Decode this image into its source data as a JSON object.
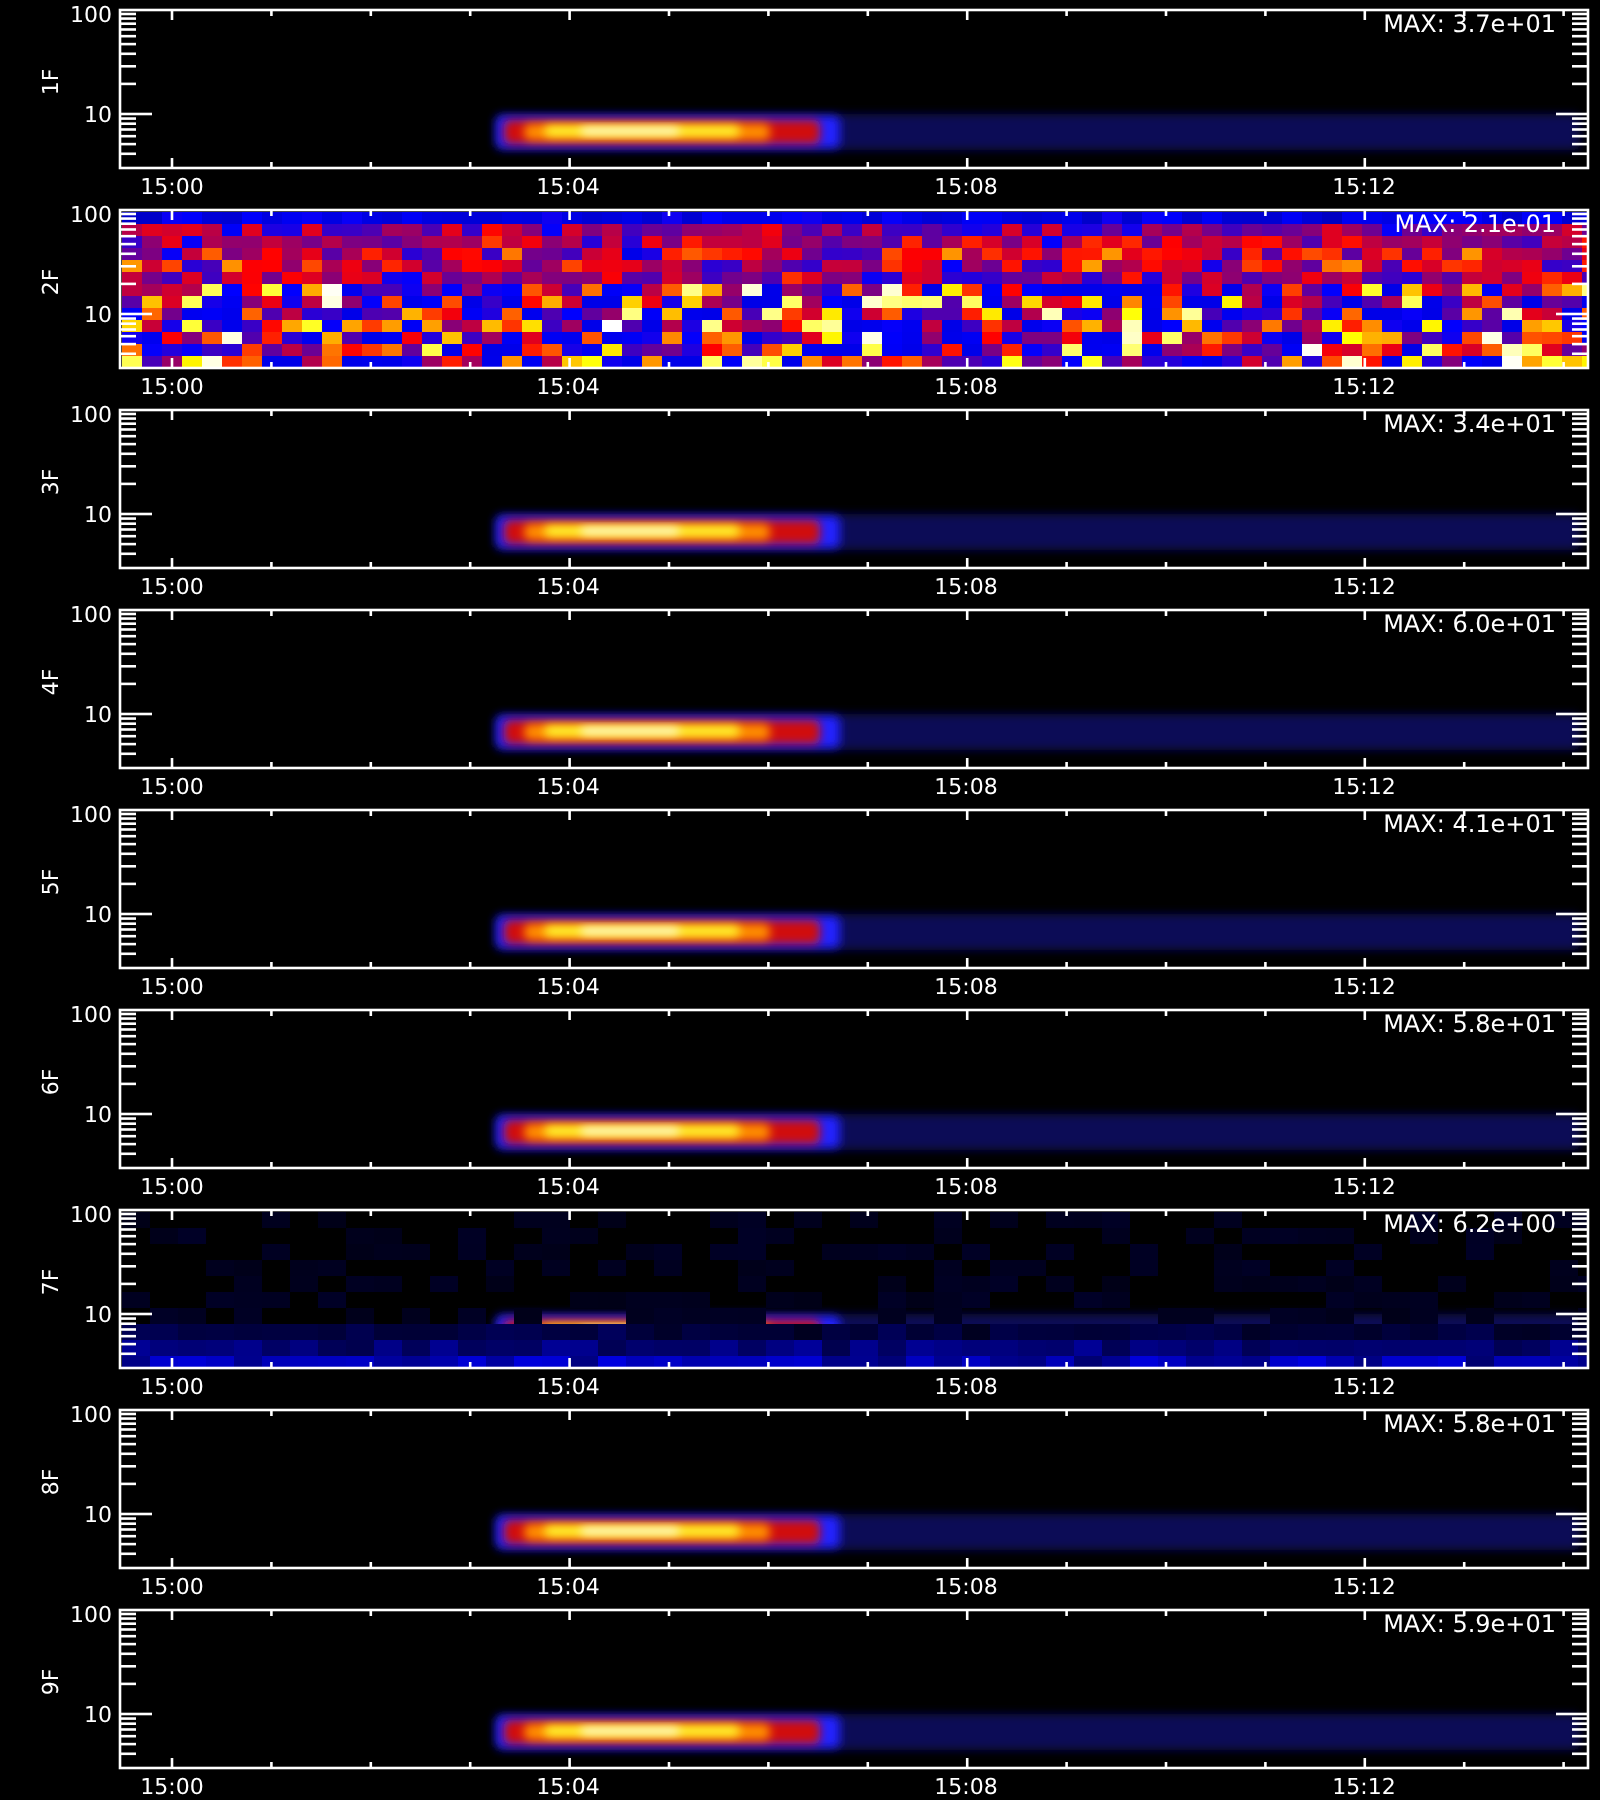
{
  "panels": [
    {
      "label": "1F",
      "kind": "burst",
      "max_text": "MAX: 3.7e+01",
      "y_tick_labels": [
        "100",
        "10"
      ],
      "x_tick_labels": [
        "15:00",
        "15:04",
        "15:08",
        "15:12"
      ]
    },
    {
      "label": "2F",
      "kind": "noise",
      "max_text": "MAX: 2.1e-01",
      "y_tick_labels": [
        "100",
        "10"
      ],
      "x_tick_labels": [
        "15:00",
        "15:04",
        "15:08",
        "15:12"
      ]
    },
    {
      "label": "3F",
      "kind": "burst",
      "max_text": "MAX: 3.4e+01",
      "y_tick_labels": [
        "100",
        "10"
      ],
      "x_tick_labels": [
        "15:00",
        "15:04",
        "15:08",
        "15:12"
      ]
    },
    {
      "label": "4F",
      "kind": "burst",
      "max_text": "MAX: 6.0e+01",
      "y_tick_labels": [
        "100",
        "10"
      ],
      "x_tick_labels": [
        "15:00",
        "15:04",
        "15:08",
        "15:12"
      ]
    },
    {
      "label": "5F",
      "kind": "burst",
      "max_text": "MAX: 4.1e+01",
      "y_tick_labels": [
        "100",
        "10"
      ],
      "x_tick_labels": [
        "15:00",
        "15:04",
        "15:08",
        "15:12"
      ]
    },
    {
      "label": "6F",
      "kind": "burst",
      "max_text": "MAX: 5.8e+01",
      "y_tick_labels": [
        "100",
        "10"
      ],
      "x_tick_labels": [
        "15:00",
        "15:04",
        "15:08",
        "15:12"
      ]
    },
    {
      "label": "7F",
      "kind": "burst-noisy",
      "max_text": "MAX: 6.2e+00",
      "y_tick_labels": [
        "100",
        "10"
      ],
      "x_tick_labels": [
        "15:00",
        "15:04",
        "15:08",
        "15:12"
      ]
    },
    {
      "label": "8F",
      "kind": "burst",
      "max_text": "MAX: 5.8e+01",
      "y_tick_labels": [
        "100",
        "10"
      ],
      "x_tick_labels": [
        "15:00",
        "15:04",
        "15:08",
        "15:12"
      ]
    },
    {
      "label": "9F",
      "kind": "burst",
      "max_text": "MAX: 5.9e+01",
      "y_tick_labels": [
        "100",
        "10"
      ],
      "x_tick_labels": [
        "15:00",
        "15:04",
        "15:08",
        "15:12"
      ]
    }
  ]
}
